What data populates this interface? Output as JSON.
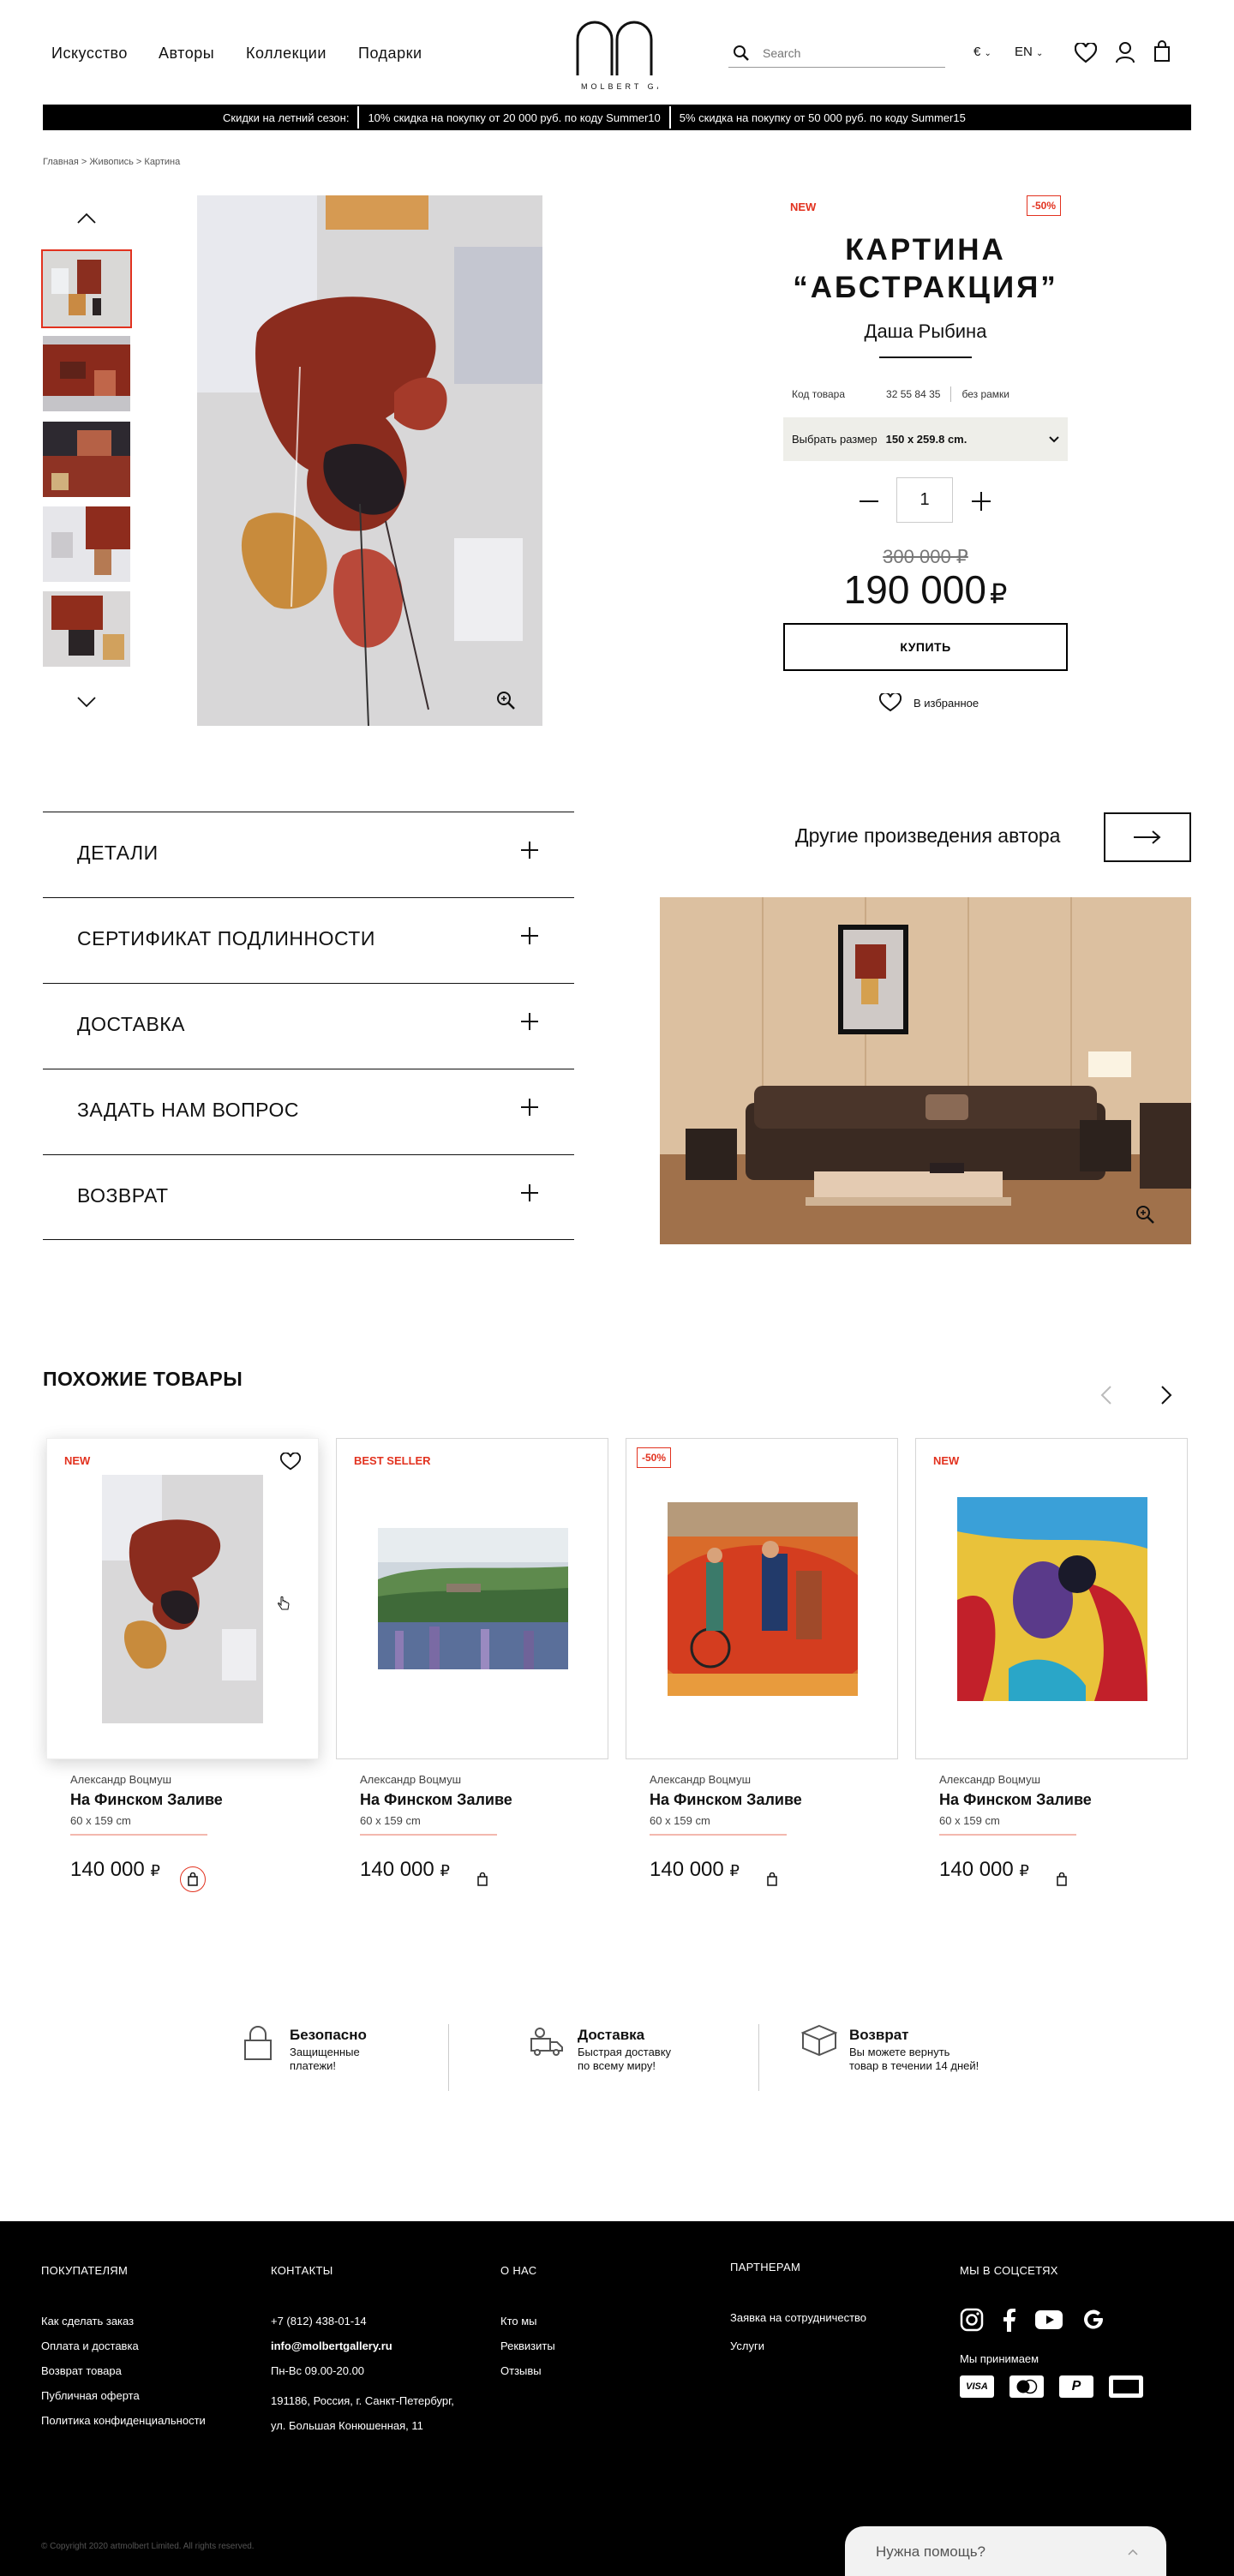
{
  "header": {
    "nav": [
      "Искусство",
      "Авторы",
      "Коллекции",
      "Подарки"
    ],
    "logo_text": "MOLBERT GALLERY",
    "search_placeholder": "Search",
    "currency": "€",
    "language": "EN"
  },
  "promo": [
    "Скидки на летний сезон:",
    "10% скидка на покупку от 20 000 руб. по коду Summer10",
    "5% скидка на покупку от 50 000 руб. по коду Summer15"
  ],
  "breadcrumb": "Главная > Живопись > Картина",
  "product": {
    "badge_new": "NEW",
    "badge_sale": "-50%",
    "title_line1": "КАРТИНА",
    "title_line2": "“АБСТРАКЦИЯ”",
    "author": "Даша Рыбина",
    "code_label": "Код товара",
    "code_value": "32 55 84 35",
    "frame": "без рамки",
    "size_label": "Выбрать размер",
    "size_value": "150 х 259.8 cm.",
    "quantity": "1",
    "old_price": "300 000 ₽",
    "price": "190 000",
    "currency_sign": "₽",
    "buy_label": "КУПИТЬ",
    "favorite_label": "В избранное"
  },
  "accordion": [
    "ДЕТАЛИ",
    "СЕРТИФИКАТ ПОДЛИННОСТИ",
    "ДОСТАВКА",
    "ЗАДАТЬ НАМ ВОПРОС",
    "ВОЗВРАТ"
  ],
  "other_works_label": "Другие произведения автора",
  "similar": {
    "title": "ПОХОЖИЕ ТОВАРЫ",
    "items": [
      {
        "badge": "NEW",
        "author": "Александр Воцмуш",
        "name": "На Финском Заливе",
        "size": "60 х 159 cm",
        "price": "140 000",
        "currency": "₽"
      },
      {
        "badge": "BEST SELLER",
        "author": "Александр Воцмуш",
        "name": "На Финском Заливе",
        "size": "60 х 159 cm",
        "price": "140 000",
        "currency": "₽"
      },
      {
        "badge": "-50%",
        "author": "Александр Воцмуш",
        "name": "На Финском Заливе",
        "size": "60 х 159 cm",
        "price": "140 000",
        "currency": "₽"
      },
      {
        "badge": "NEW",
        "author": "Александр Воцмуш",
        "name": "На Финском Заливе",
        "size": "60 х 159 cm",
        "price": "140 000",
        "currency": "₽"
      }
    ]
  },
  "features": [
    {
      "title": "Безопасно",
      "text1": "Защищенные",
      "text2": "платежи!"
    },
    {
      "title": "Доставка",
      "text1": "Быстрая доставку",
      "text2": "по всему миру!"
    },
    {
      "title": "Возврат",
      "text1": "Вы можете вернуть",
      "text2": "товар в течении 14 дней!"
    }
  ],
  "footer": {
    "buyers": {
      "title": "ПОКУПАТЕЛЯМ",
      "items": [
        "Как сделать заказ",
        "Оплата и доставка",
        "Возврат товара",
        "Публичная оферта",
        "Политика конфиденциальности"
      ]
    },
    "contacts": {
      "title": "КОНТАКТЫ",
      "phone": "+7 (812) 438-01-14",
      "email": "info@molbertgallery.ru",
      "hours": "Пн-Вс  09.00-20.00",
      "address1": "191186, Россия, г. Санкт-Петербург,",
      "address2": "ул. Большая Конюшенная, 11"
    },
    "about": {
      "title": "О НАС",
      "items": [
        "Кто мы",
        "Реквизиты",
        "Отзывы"
      ]
    },
    "partners": {
      "title": "ПАРТНЕРАМ",
      "items": [
        "Заявка на сотрудничество",
        "Услуги"
      ]
    },
    "social": {
      "title": "МЫ В СОЦСЕТЯХ",
      "accept": "Мы принимаем"
    },
    "payments": [
      "VISA",
      "mastercard",
      "PayPal",
      "AMEX"
    ],
    "copyright": "© Copyright 2020 artmolbert Limited. All rights reserved.",
    "help": "Нужна помощь?"
  },
  "colors": {
    "accent": "#e2321f",
    "black": "#000000"
  }
}
